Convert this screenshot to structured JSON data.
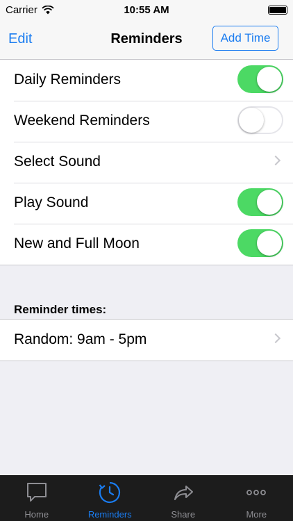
{
  "status_bar": {
    "carrier": "Carrier",
    "time": "10:55 AM"
  },
  "nav": {
    "edit_label": "Edit",
    "title": "Reminders",
    "add_label": "Add Time"
  },
  "settings": [
    {
      "label": "Daily Reminders",
      "toggle": "on"
    },
    {
      "label": "Weekend Reminders",
      "toggle": "off"
    },
    {
      "label": "Select Sound",
      "toggle": null
    },
    {
      "label": "Play Sound",
      "toggle": "on"
    },
    {
      "label": "New and Full Moon",
      "toggle": "on"
    }
  ],
  "reminder_times": {
    "header": "Reminder times:",
    "items": [
      {
        "label": "Random: 9am - 5pm"
      }
    ]
  },
  "tabs": [
    {
      "label": "Home",
      "icon": "chat-bubble-icon",
      "active": false
    },
    {
      "label": "Reminders",
      "icon": "clock-refresh-icon",
      "active": true
    },
    {
      "label": "Share",
      "icon": "share-arrow-icon",
      "active": false
    },
    {
      "label": "More",
      "icon": "more-dots-icon",
      "active": false
    }
  ],
  "colors": {
    "accent": "#1a7cf0",
    "toggle_on": "#4cd964",
    "background": "#efeff4",
    "tab_bar": "#1c1c1c"
  }
}
